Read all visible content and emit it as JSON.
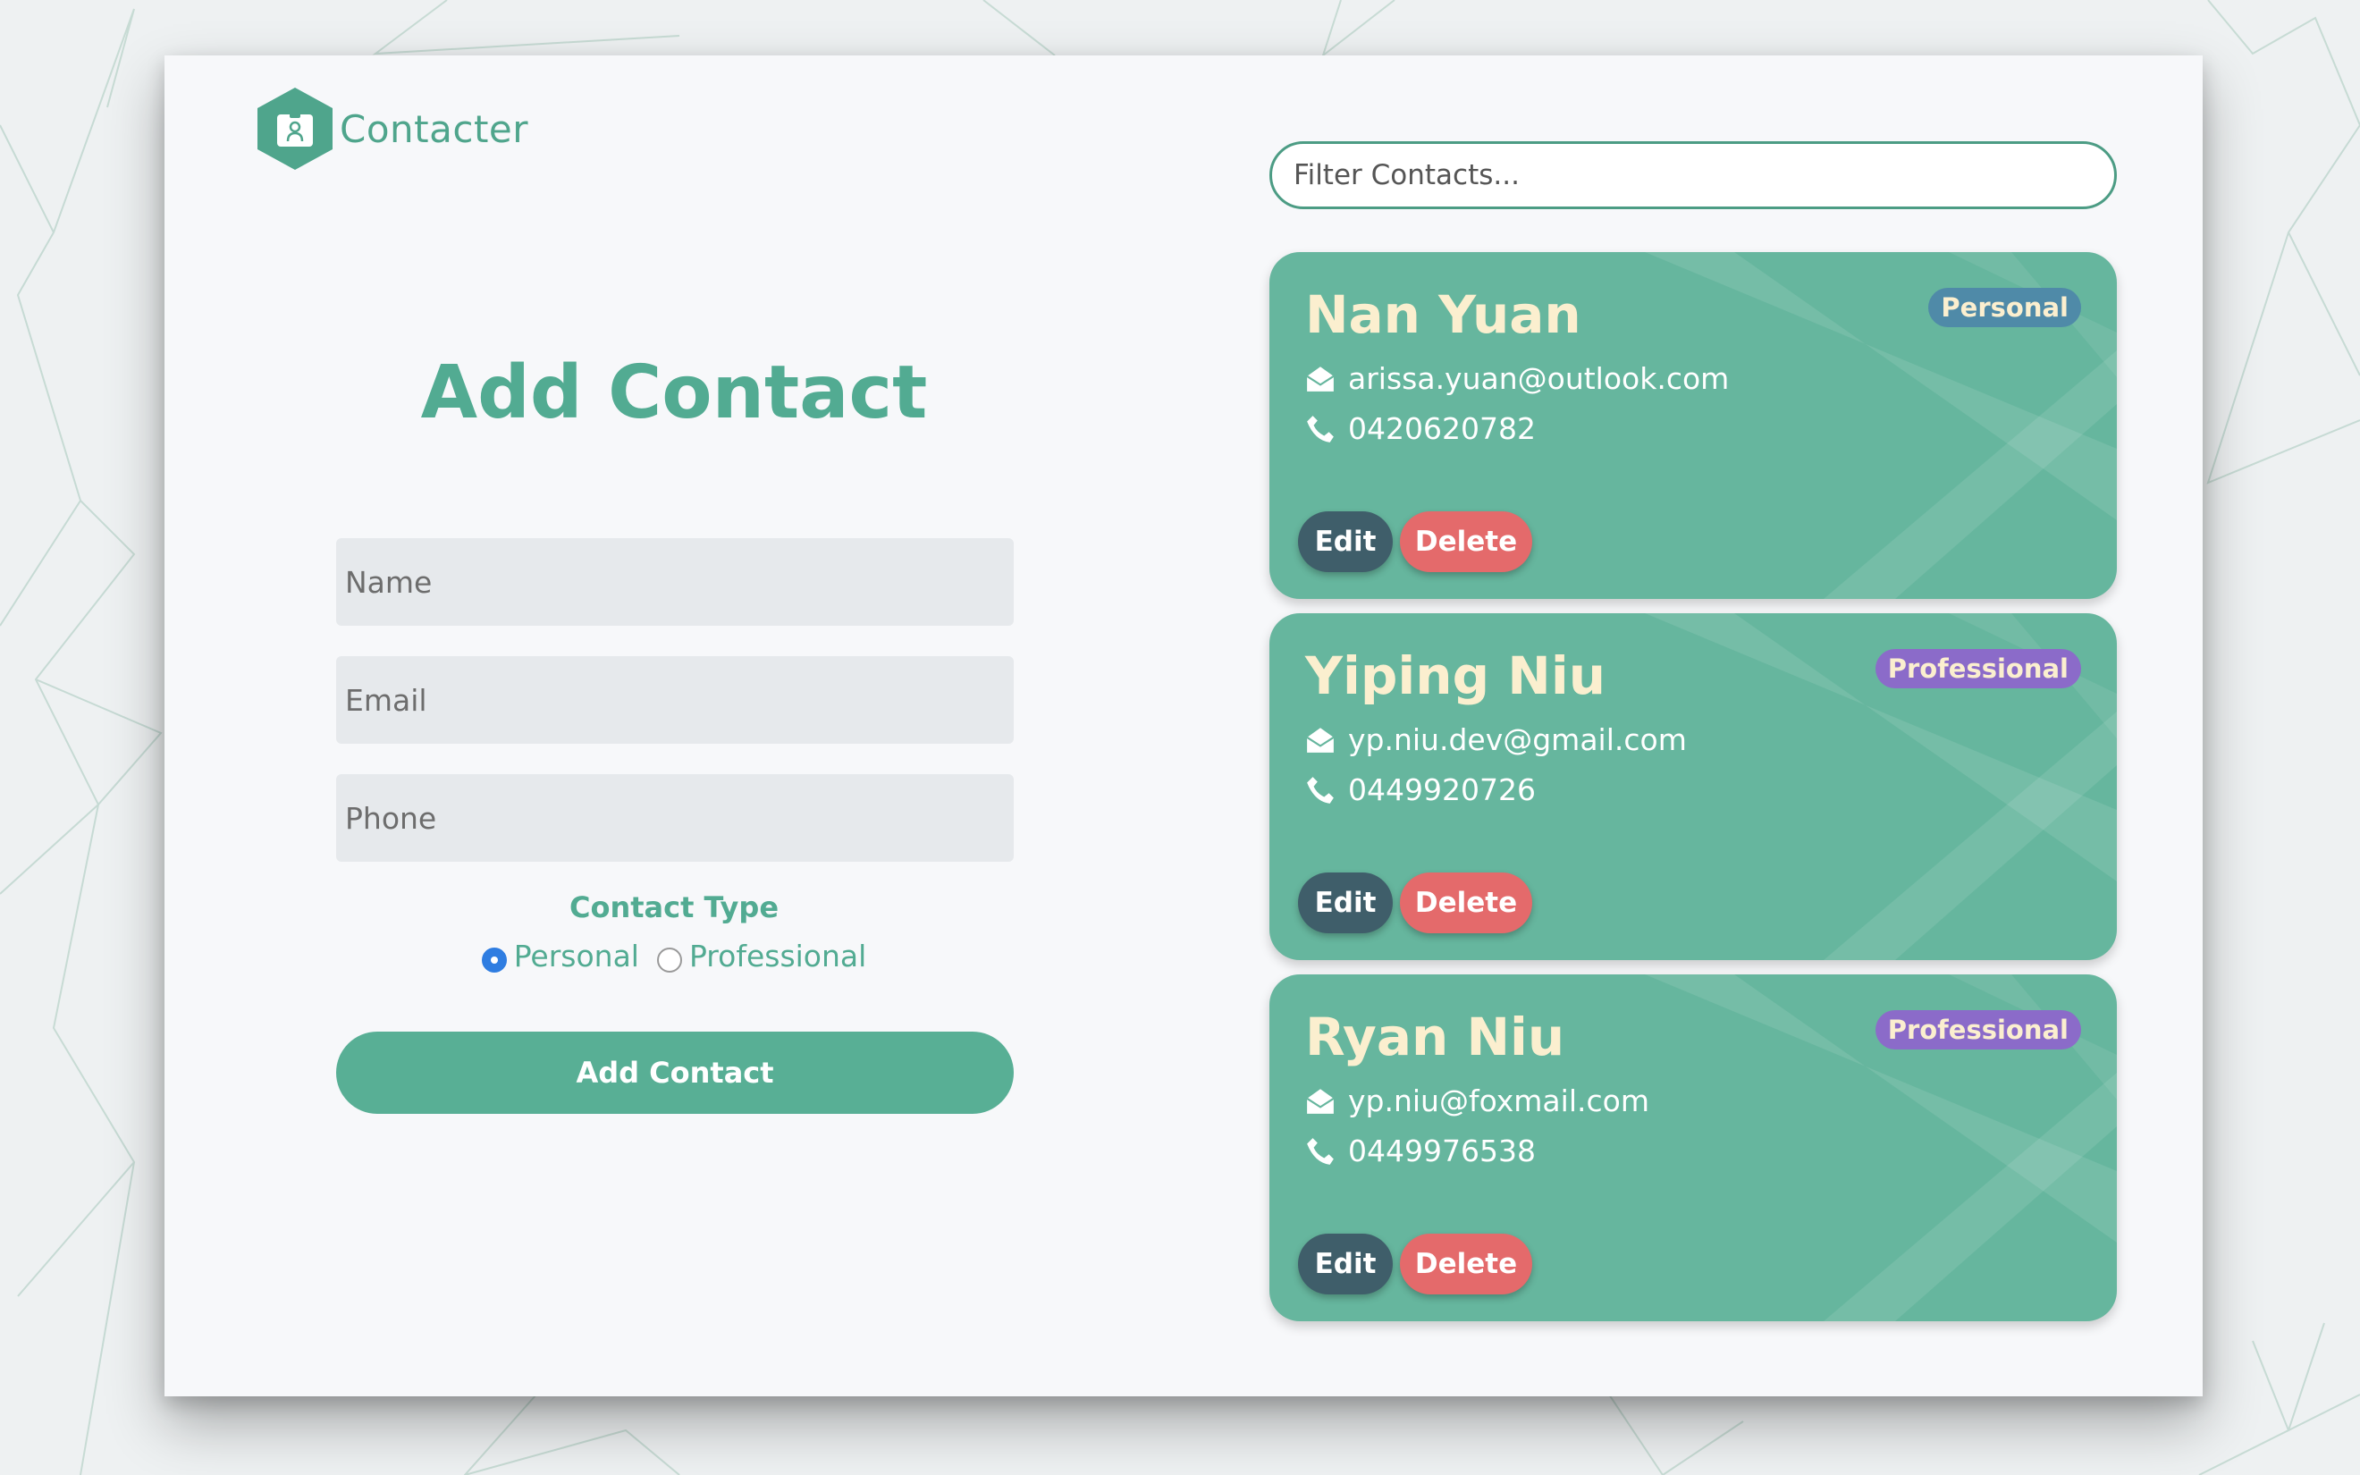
{
  "app": {
    "name": "Contacter"
  },
  "form": {
    "title": "Add Contact",
    "name_placeholder": "Name",
    "email_placeholder": "Email",
    "phone_placeholder": "Phone",
    "type_label": "Contact Type",
    "type_options": [
      {
        "label": "Personal",
        "selected": true
      },
      {
        "label": "Professional",
        "selected": false
      }
    ],
    "submit_label": "Add Contact"
  },
  "filter": {
    "placeholder": "Filter Contacts..."
  },
  "contacts": [
    {
      "name": "Nan Yuan",
      "type": "Personal",
      "email": "arissa.yuan@outlook.com",
      "phone": "0420620782",
      "edit_label": "Edit",
      "delete_label": "Delete"
    },
    {
      "name": "Yiping Niu",
      "type": "Professional",
      "email": "yp.niu.dev@gmail.com",
      "phone": "0449920726",
      "edit_label": "Edit",
      "delete_label": "Delete"
    },
    {
      "name": "Ryan Niu",
      "type": "Professional",
      "email": "yp.niu@foxmail.com",
      "phone": "0449976538",
      "edit_label": "Edit",
      "delete_label": "Delete"
    }
  ],
  "colors": {
    "brand": "#52ab92",
    "card_bg": "#66b69e",
    "name_text": "#fbefcf",
    "badge_personal": "#4f8aa8",
    "badge_professional": "#8b6bc9",
    "edit_button": "#3f5e6a",
    "delete_button": "#e46a6b",
    "radio_selected": "#2f7de1"
  }
}
